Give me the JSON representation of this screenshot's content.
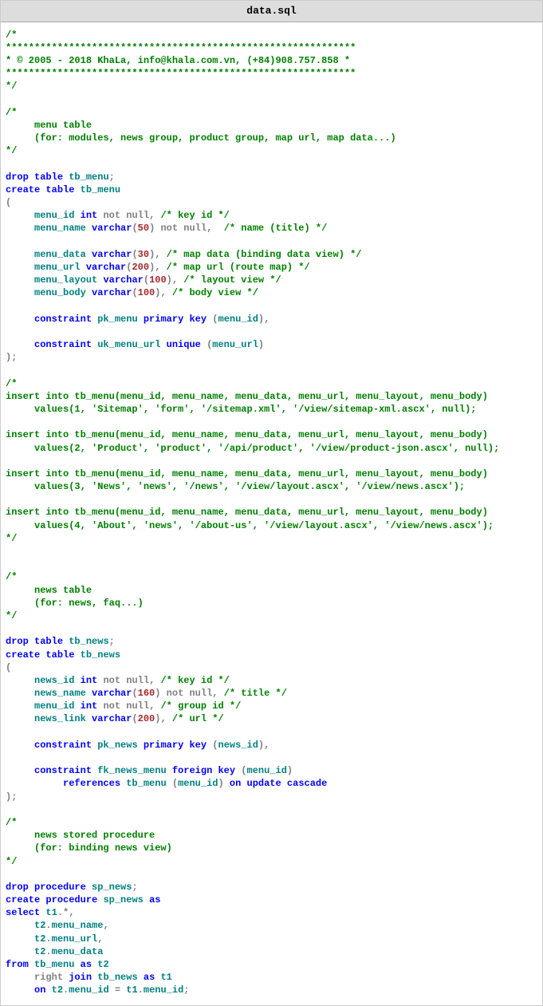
{
  "filename": "data.sql",
  "code": {
    "header_comment": [
      "/*",
      "*************************************************************",
      "* © 2005 - 2018 KhaLa, info@khala.com.vn, (+84)908.757.858 *",
      "*************************************************************",
      "*/"
    ],
    "menu_comment": [
      "/*",
      "     menu table",
      "     (for: modules, news group, product group, map url, map data...)",
      "*/"
    ],
    "menu_table": {
      "drop": "drop table tb_menu;",
      "create": "create table tb_menu",
      "fields": [
        {
          "name": "menu_id",
          "type": "int",
          "nullable": "not null",
          "comment": "/* key id */"
        },
        {
          "name": "menu_name",
          "type": "varchar",
          "size": "50",
          "nullable": "not null",
          "comment": "/* name (title) */"
        },
        {
          "name": "menu_data",
          "type": "varchar",
          "size": "30",
          "comment": "/* map data (binding data view) */"
        },
        {
          "name": "menu_url",
          "type": "varchar",
          "size": "200",
          "comment": "/* map url (route map) */"
        },
        {
          "name": "menu_layout",
          "type": "varchar",
          "size": "100",
          "comment": "/* layout view */"
        },
        {
          "name": "menu_body",
          "type": "varchar",
          "size": "100",
          "comment": "/* body view */"
        }
      ],
      "pk": {
        "name": "pk_menu",
        "col": "menu_id"
      },
      "uk": {
        "name": "uk_menu_url",
        "col": "menu_url"
      }
    },
    "insert_comment": [
      "/*",
      "insert into tb_menu(menu_id, menu_name, menu_data, menu_url, menu_layout, menu_body)",
      "     values(1, 'Sitemap', 'form', '/sitemap.xml', '/view/sitemap-xml.ascx', null);",
      "",
      "insert into tb_menu(menu_id, menu_name, menu_data, menu_url, menu_layout, menu_body)",
      "     values(2, 'Product', 'product', '/api/product', '/view/product-json.ascx', null);",
      "",
      "insert into tb_menu(menu_id, menu_name, menu_data, menu_url, menu_layout, menu_body)",
      "     values(3, 'News', 'news', '/news', '/view/layout.ascx', '/view/news.ascx');",
      "",
      "insert into tb_menu(menu_id, menu_name, menu_data, menu_url, menu_layout, menu_body)",
      "     values(4, 'About', 'news', '/about-us', '/view/layout.ascx', '/view/news.ascx');",
      "*/"
    ],
    "news_comment": [
      "/*",
      "     news table",
      "     (for: news, faq...)",
      "*/"
    ],
    "news_table": {
      "drop": "drop table tb_news;",
      "create": "create table tb_news",
      "fields": [
        {
          "name": "news_id",
          "type": "int",
          "nullable": "not null",
          "comment": "/* key id */"
        },
        {
          "name": "news_name",
          "type": "varchar",
          "size": "160",
          "nullable": "not null",
          "comment": "/* title */"
        },
        {
          "name": "menu_id",
          "type": "int",
          "nullable": "not null",
          "comment": "/* group id */"
        },
        {
          "name": "news_link",
          "type": "varchar",
          "size": "200",
          "comment": "/* url */"
        }
      ],
      "pk": {
        "name": "pk_news",
        "col": "news_id"
      },
      "fk": {
        "name": "fk_news_menu",
        "col": "menu_id",
        "ref_table": "tb_menu",
        "ref_col": "menu_id"
      }
    },
    "proc_comment": [
      "/*",
      "     news stored procedure",
      "     (for: binding news view)",
      "*/"
    ],
    "proc": {
      "drop": "drop procedure sp_news;",
      "create": "create procedure sp_news as",
      "select": "select t1.*,",
      "cols": [
        "t2.menu_name",
        "t2.menu_url",
        "t2.menu_data"
      ],
      "from": "from tb_menu as t2",
      "join": "right join tb_news as t1",
      "on": "on t2.menu_id = t1.menu_id;"
    }
  }
}
